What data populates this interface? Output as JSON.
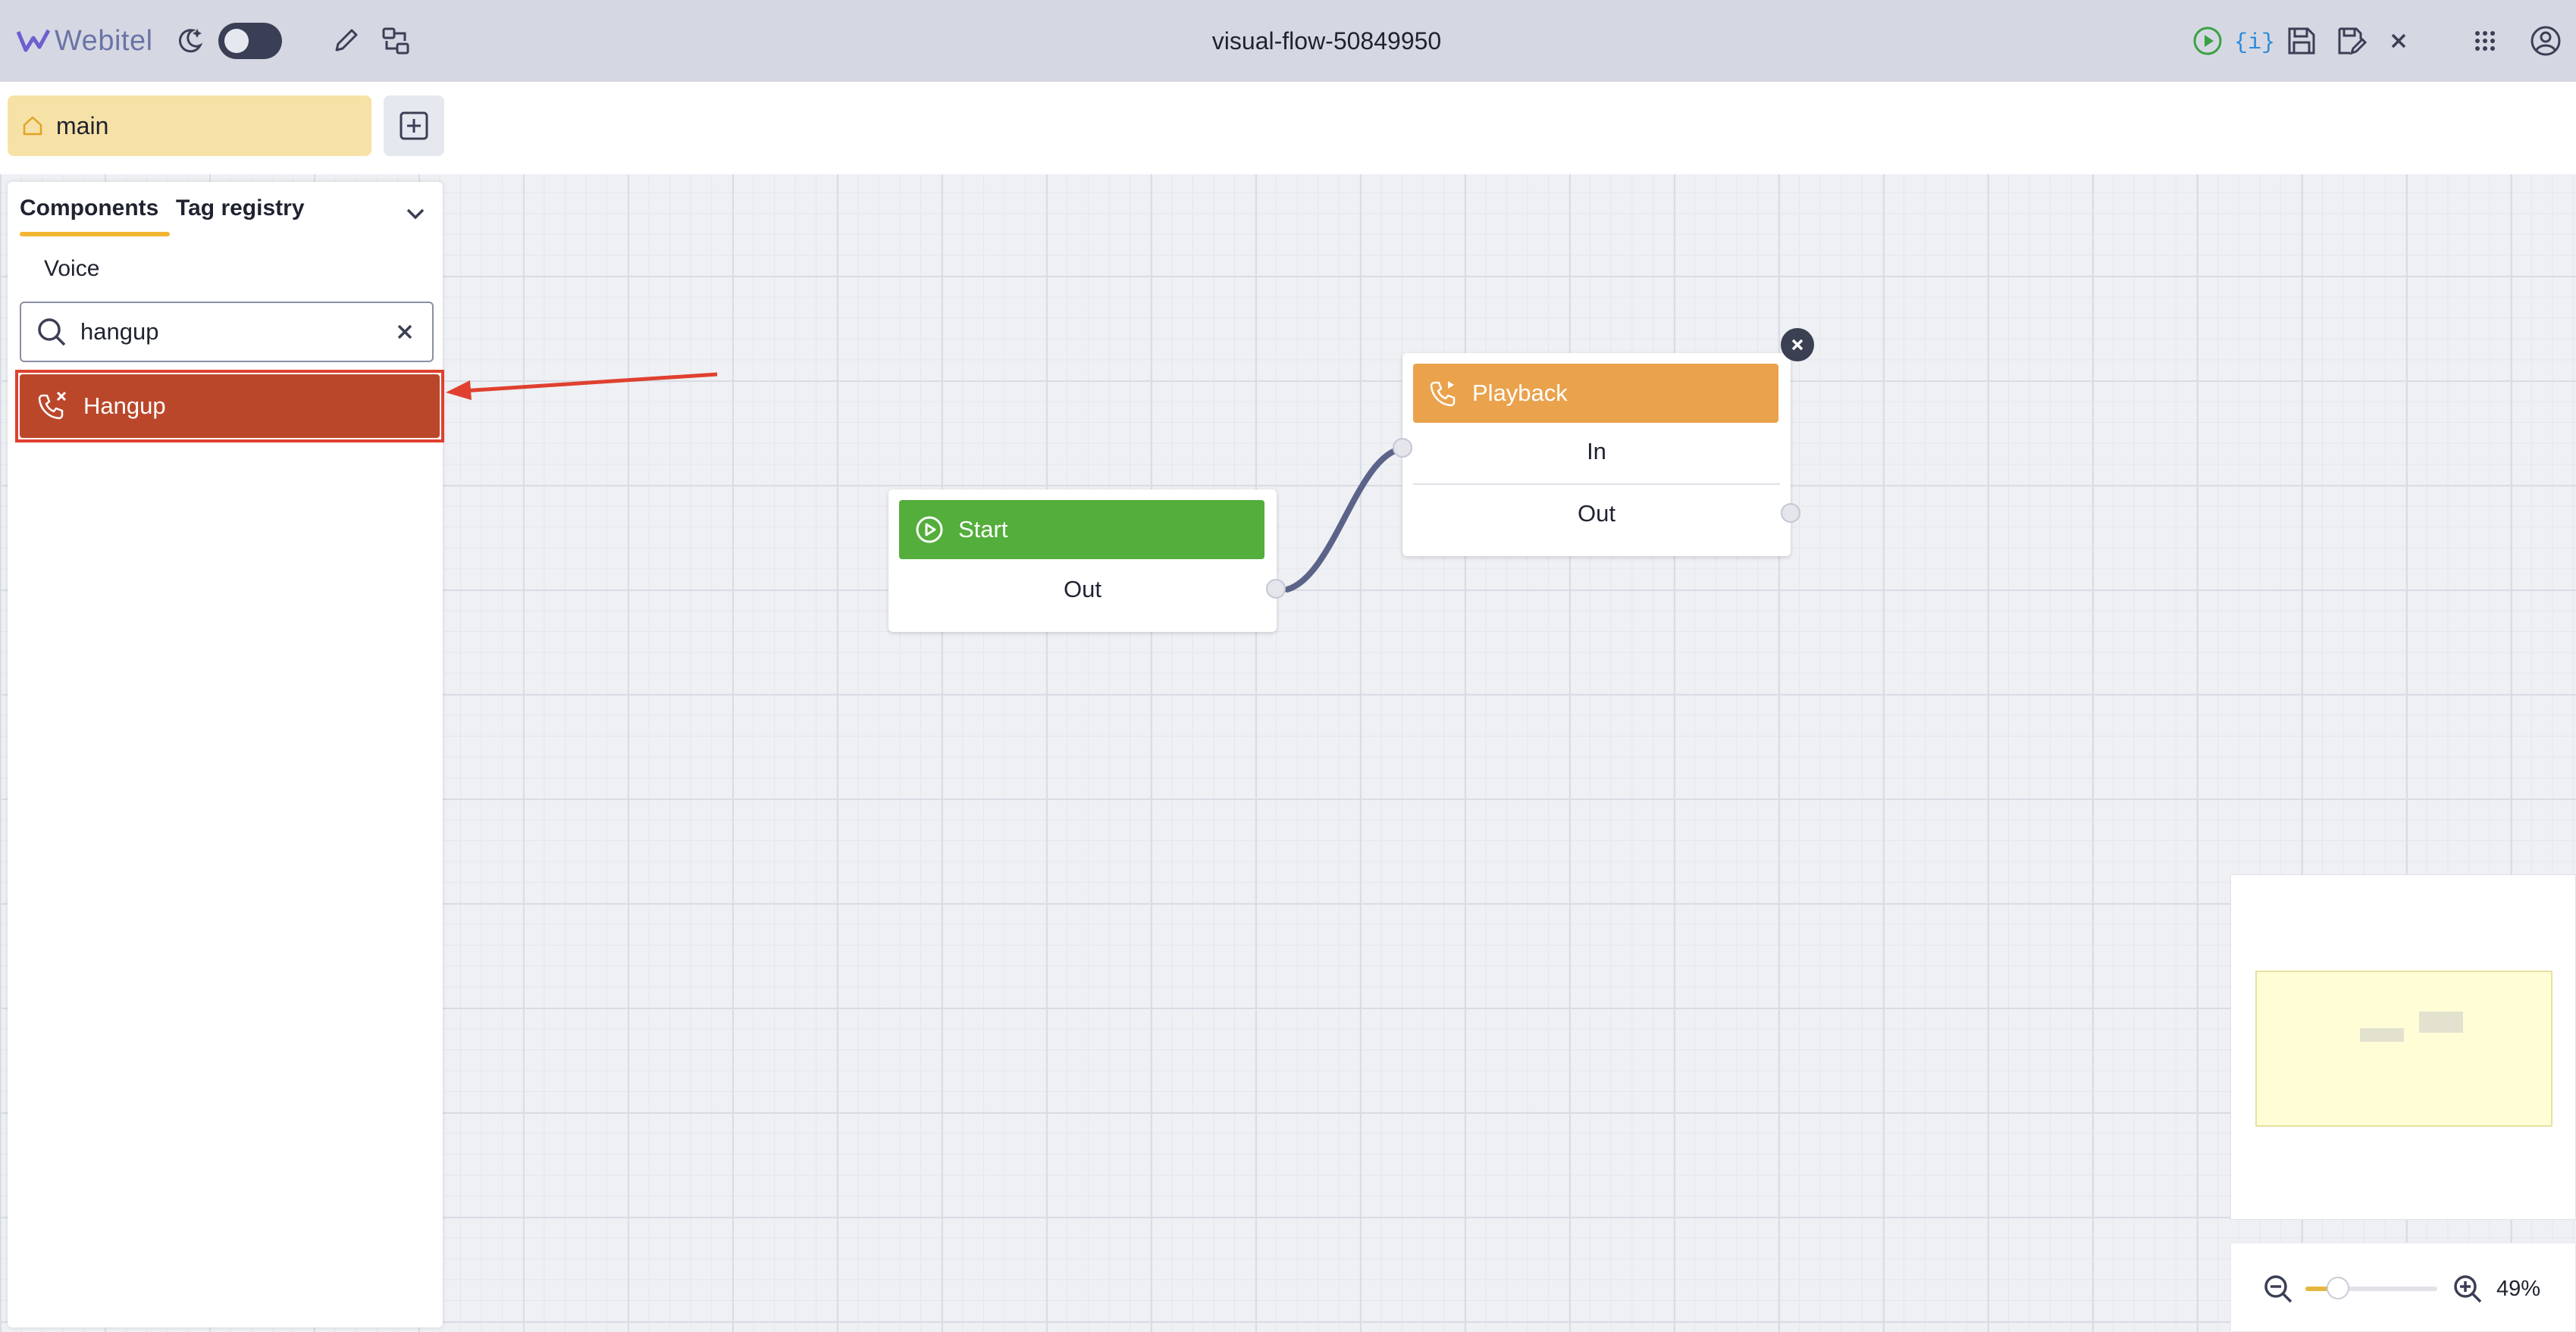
{
  "app": {
    "logo_text": "Webitel",
    "title": "visual-flow-50849950"
  },
  "header": {
    "left_icons": [
      "moon-icon",
      "theme-toggle",
      "pencil-icon",
      "transfer-icon"
    ],
    "right_icons": [
      "play-icon",
      "variables-icon",
      "save-icon",
      "save-as-icon",
      "close-icon",
      "apps-grid-icon",
      "account-icon"
    ]
  },
  "tabs": {
    "main_label": "main"
  },
  "panel": {
    "tab_components": "Components",
    "tab_tag_registry": "Tag registry",
    "category": "Voice",
    "search_value": "hangup",
    "search_placeholder": "Search",
    "results": [
      {
        "label": "Hangup",
        "color": "#bb472b"
      }
    ]
  },
  "nodes": {
    "start": {
      "title": "Start",
      "out_label": "Out",
      "color": "#53ae3b"
    },
    "playback": {
      "title": "Playback",
      "in_label": "In",
      "out_label": "Out",
      "color": "#eaa24c"
    }
  },
  "zoom": {
    "value_label": "49%",
    "level": 0.49
  },
  "colors": {
    "accent": "#f2b633",
    "header_bg": "#d5d8e2",
    "canvas_bg": "#eef0f4",
    "annotation": "#e0402f"
  }
}
